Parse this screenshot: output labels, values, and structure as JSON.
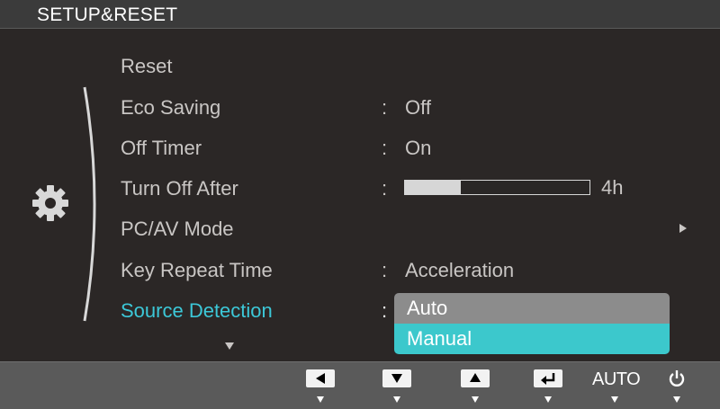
{
  "header": {
    "title": "SETUP&RESET"
  },
  "menu": {
    "items": [
      {
        "label": "Reset",
        "value": ""
      },
      {
        "label": "Eco Saving",
        "value": "Off"
      },
      {
        "label": "Off Timer",
        "value": "On"
      },
      {
        "label": "Turn Off After",
        "value": "4h",
        "progress": 0.3
      },
      {
        "label": "PC/AV Mode",
        "value": ""
      },
      {
        "label": "Key Repeat Time",
        "value": "Acceleration"
      },
      {
        "label": "Source Detection",
        "value": ""
      }
    ],
    "selected_index": 6
  },
  "dropdown": {
    "options": [
      "Auto",
      "Manual"
    ],
    "selected": "Manual"
  },
  "bottom_bar": {
    "buttons": [
      "left-arrow-icon",
      "down-arrow-icon",
      "up-arrow-icon",
      "enter-icon",
      "AUTO",
      "power-icon"
    ],
    "auto_label": "AUTO"
  },
  "colors": {
    "accent": "#3cc8d8",
    "dropdown_selected": "#3cc8cc",
    "dropdown_bg": "#8c8c8c",
    "background": "#2b2726",
    "header_bg": "#3b3b3b",
    "bottom_bar_bg": "#5a5a5a",
    "text": "#c9c6c4"
  }
}
